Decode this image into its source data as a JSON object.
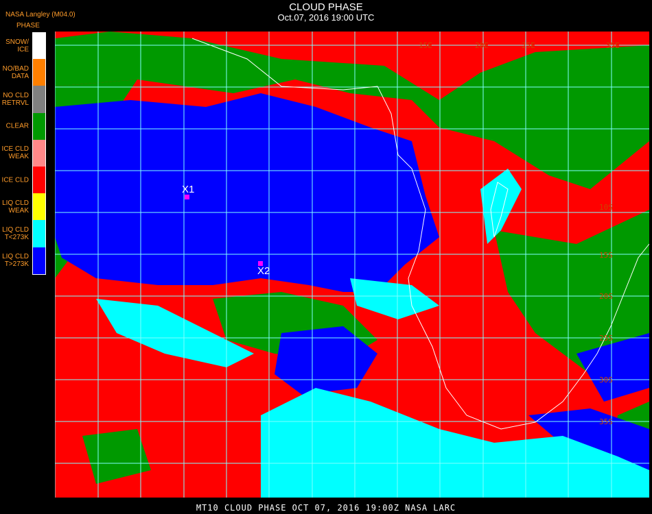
{
  "header": {
    "title": "CLOUD PHASE",
    "subtitle": "Oct.07, 2016 19:00 UTC",
    "source": "NASA Langley (M04.0)"
  },
  "legend": {
    "title": "PHASE",
    "items": [
      {
        "label": "SNOW/\nICE",
        "color": "#ffffff"
      },
      {
        "label": "NO/BAD\nDATA",
        "color": "#ff7f00"
      },
      {
        "label": "NO CLD\nRETRVL",
        "color": "#808080"
      },
      {
        "label": "CLEAR",
        "color": "#009900"
      },
      {
        "label": "ICE CLD\nWEAK",
        "color": "#ff8888"
      },
      {
        "label": "ICE CLD",
        "color": "#ff0000"
      },
      {
        "label": "LIQ CLD\nWEAK",
        "color": "#ffff00"
      },
      {
        "label": "LIQ CLD\nT<273K",
        "color": "#00ffff"
      },
      {
        "label": "LIQ CLD\nT>273K",
        "color": "#0000ff"
      }
    ]
  },
  "markers": [
    {
      "label": "X1"
    },
    {
      "label": "X2"
    }
  ],
  "grid_labels": {
    "longitude": [
      "15E",
      "20E",
      "25E",
      "35E"
    ],
    "latitude": [
      "10S",
      "15S",
      "20S",
      "25S",
      "30S",
      "35S"
    ]
  },
  "footer": "MT10   CLOUD PHASE   OCT 07, 2016 19:00Z   NASA LARC",
  "colors": {
    "clear": "#009900",
    "ice": "#ff0000",
    "liq_warm": "#0000ff",
    "liq_cold": "#00ffff",
    "grid": "#80ffff",
    "coast": "#ffffff",
    "grid_label": "#cc4400"
  }
}
